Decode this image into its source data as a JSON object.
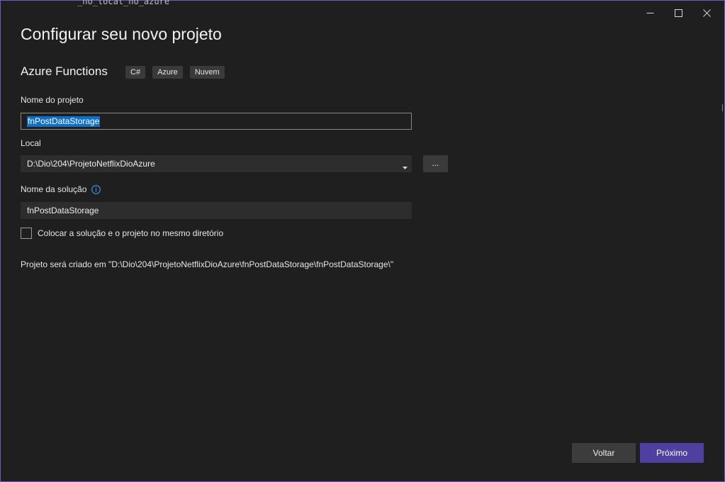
{
  "window": {
    "controls": {
      "minimize_icon": "minimize-icon",
      "maximize_icon": "maximize-icon",
      "close_icon": "close-icon"
    },
    "background_fragment": "_no_local_no_azure"
  },
  "header": {
    "title": "Configurar seu novo projeto",
    "template_name": "Azure Functions",
    "tags": [
      "C#",
      "Azure",
      "Nuvem"
    ]
  },
  "form": {
    "project_name": {
      "label": "Nome do projeto",
      "value": "fnPostDataStorage"
    },
    "location": {
      "label": "Local",
      "value": "D:\\Dio\\204\\ProjetoNetflixDioAzure",
      "browse_label": "..."
    },
    "solution_name": {
      "label": "Nome da solução",
      "value": "fnPostDataStorage",
      "info_icon": "info-icon"
    },
    "same_directory": {
      "label": "Colocar a solução e o projeto no mesmo diretório",
      "checked": false
    },
    "path_preview": "Projeto será criado em \"D:\\Dio\\204\\ProjetoNetflixDioAzure\\fnPostDataStorage\\fnPostDataStorage\\\""
  },
  "footer": {
    "back_label": "Voltar",
    "next_label": "Próximo"
  },
  "colors": {
    "accent": "#4f3fa0",
    "selection": "#0e6fc4",
    "window_border": "#6b5fc7",
    "background": "#1f1f1f"
  }
}
